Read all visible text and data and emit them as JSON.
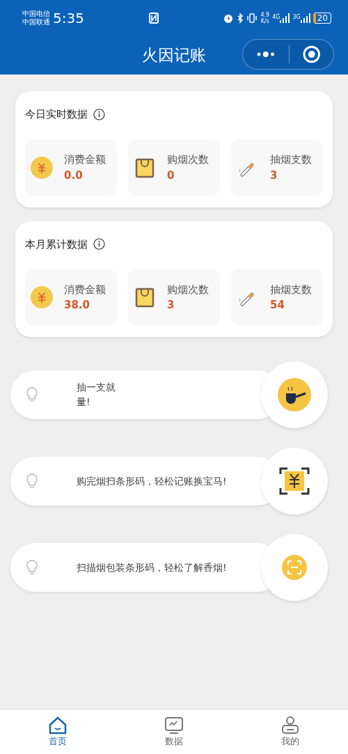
{
  "status_bar": {
    "carrier_1": "中国电信",
    "carrier_2": "中国联通",
    "time": "5:35",
    "speed_value": "4.9",
    "speed_unit": "K/s",
    "network_1": "4G",
    "network_2": "3G",
    "battery": "20"
  },
  "nav_bar": {
    "title": "火因记账"
  },
  "sections": [
    {
      "title": "今日实时数据",
      "stats": [
        {
          "kind": "money",
          "label": "消费金额",
          "value": "0.0"
        },
        {
          "kind": "bag",
          "label": "购烟次数",
          "value": "0"
        },
        {
          "kind": "cigarette",
          "label": "抽烟支数",
          "value": "3"
        }
      ]
    },
    {
      "title": "本月累计数据",
      "stats": [
        {
          "kind": "money",
          "label": "消费金额",
          "value": "38.0"
        },
        {
          "kind": "bag",
          "label": "购烟次数",
          "value": "3"
        },
        {
          "kind": "cigarette",
          "label": "抽烟支数",
          "value": "54"
        }
      ]
    }
  ],
  "tips": [
    {
      "kind": "pipe",
      "lines": [
        "抽一支就",
        "量!"
      ]
    },
    {
      "kind": "scan_money",
      "lines": [
        "购完烟扫条形码，轻松记账换宝马!"
      ]
    },
    {
      "kind": "scan",
      "lines": [
        "扫描烟包装条形码，轻松了解香烟!"
      ]
    }
  ],
  "tab_bar": [
    {
      "kind": "home",
      "label": "首页",
      "selected": true
    },
    {
      "kind": "chart",
      "label": "数据",
      "selected": false
    },
    {
      "kind": "user",
      "label": "我的",
      "selected": false
    }
  ]
}
